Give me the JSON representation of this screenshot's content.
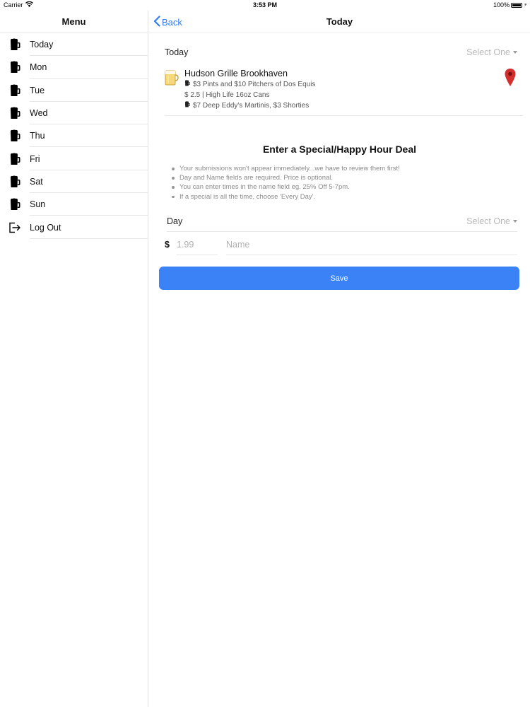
{
  "status_bar": {
    "carrier": "Carrier",
    "time": "3:53 PM",
    "battery": "100%"
  },
  "sidebar": {
    "title": "Menu",
    "items": [
      {
        "label": "Today",
        "icon": "beer-mug-icon"
      },
      {
        "label": "Mon",
        "icon": "beer-mug-icon"
      },
      {
        "label": "Tue",
        "icon": "beer-mug-icon"
      },
      {
        "label": "Wed",
        "icon": "beer-mug-icon"
      },
      {
        "label": "Thu",
        "icon": "beer-mug-icon"
      },
      {
        "label": "Fri",
        "icon": "beer-mug-icon"
      },
      {
        "label": "Sat",
        "icon": "beer-mug-icon"
      },
      {
        "label": "Sun",
        "icon": "beer-mug-icon"
      },
      {
        "label": "Log Out",
        "icon": "logout-icon"
      }
    ]
  },
  "nav": {
    "back_label": "Back",
    "title": "Today"
  },
  "today_section": {
    "label": "Today",
    "select_label": "Select One"
  },
  "venue": {
    "name": "Hudson Grille Brookhaven",
    "specials": [
      {
        "text": "$3 Pints and $10 Pitchers of Dos Equis",
        "has_icon": true
      },
      {
        "text": "$ 2.5 | High Life 16oz Cans",
        "has_icon": false
      },
      {
        "text": "$7 Deep Eddy's Martinis, $3 Shorties",
        "has_icon": true
      }
    ]
  },
  "form": {
    "title": "Enter a Special/Happy Hour Deal",
    "notes": [
      "Your submissions won't appear immediately...we have to review them first!",
      "Day and Name fields are required. Price is optional.",
      "You can enter times in the name field eg. 25% Off 5-7pm.",
      "If a special is all the time, choose 'Every Day'."
    ],
    "day_label": "Day",
    "day_select": "Select One",
    "currency": "$",
    "price_placeholder": "1.99",
    "name_placeholder": "Name",
    "save_label": "Save"
  },
  "colors": {
    "accent": "#3b82f6",
    "link": "#2f7cf6",
    "pin": "#d32f2f"
  }
}
